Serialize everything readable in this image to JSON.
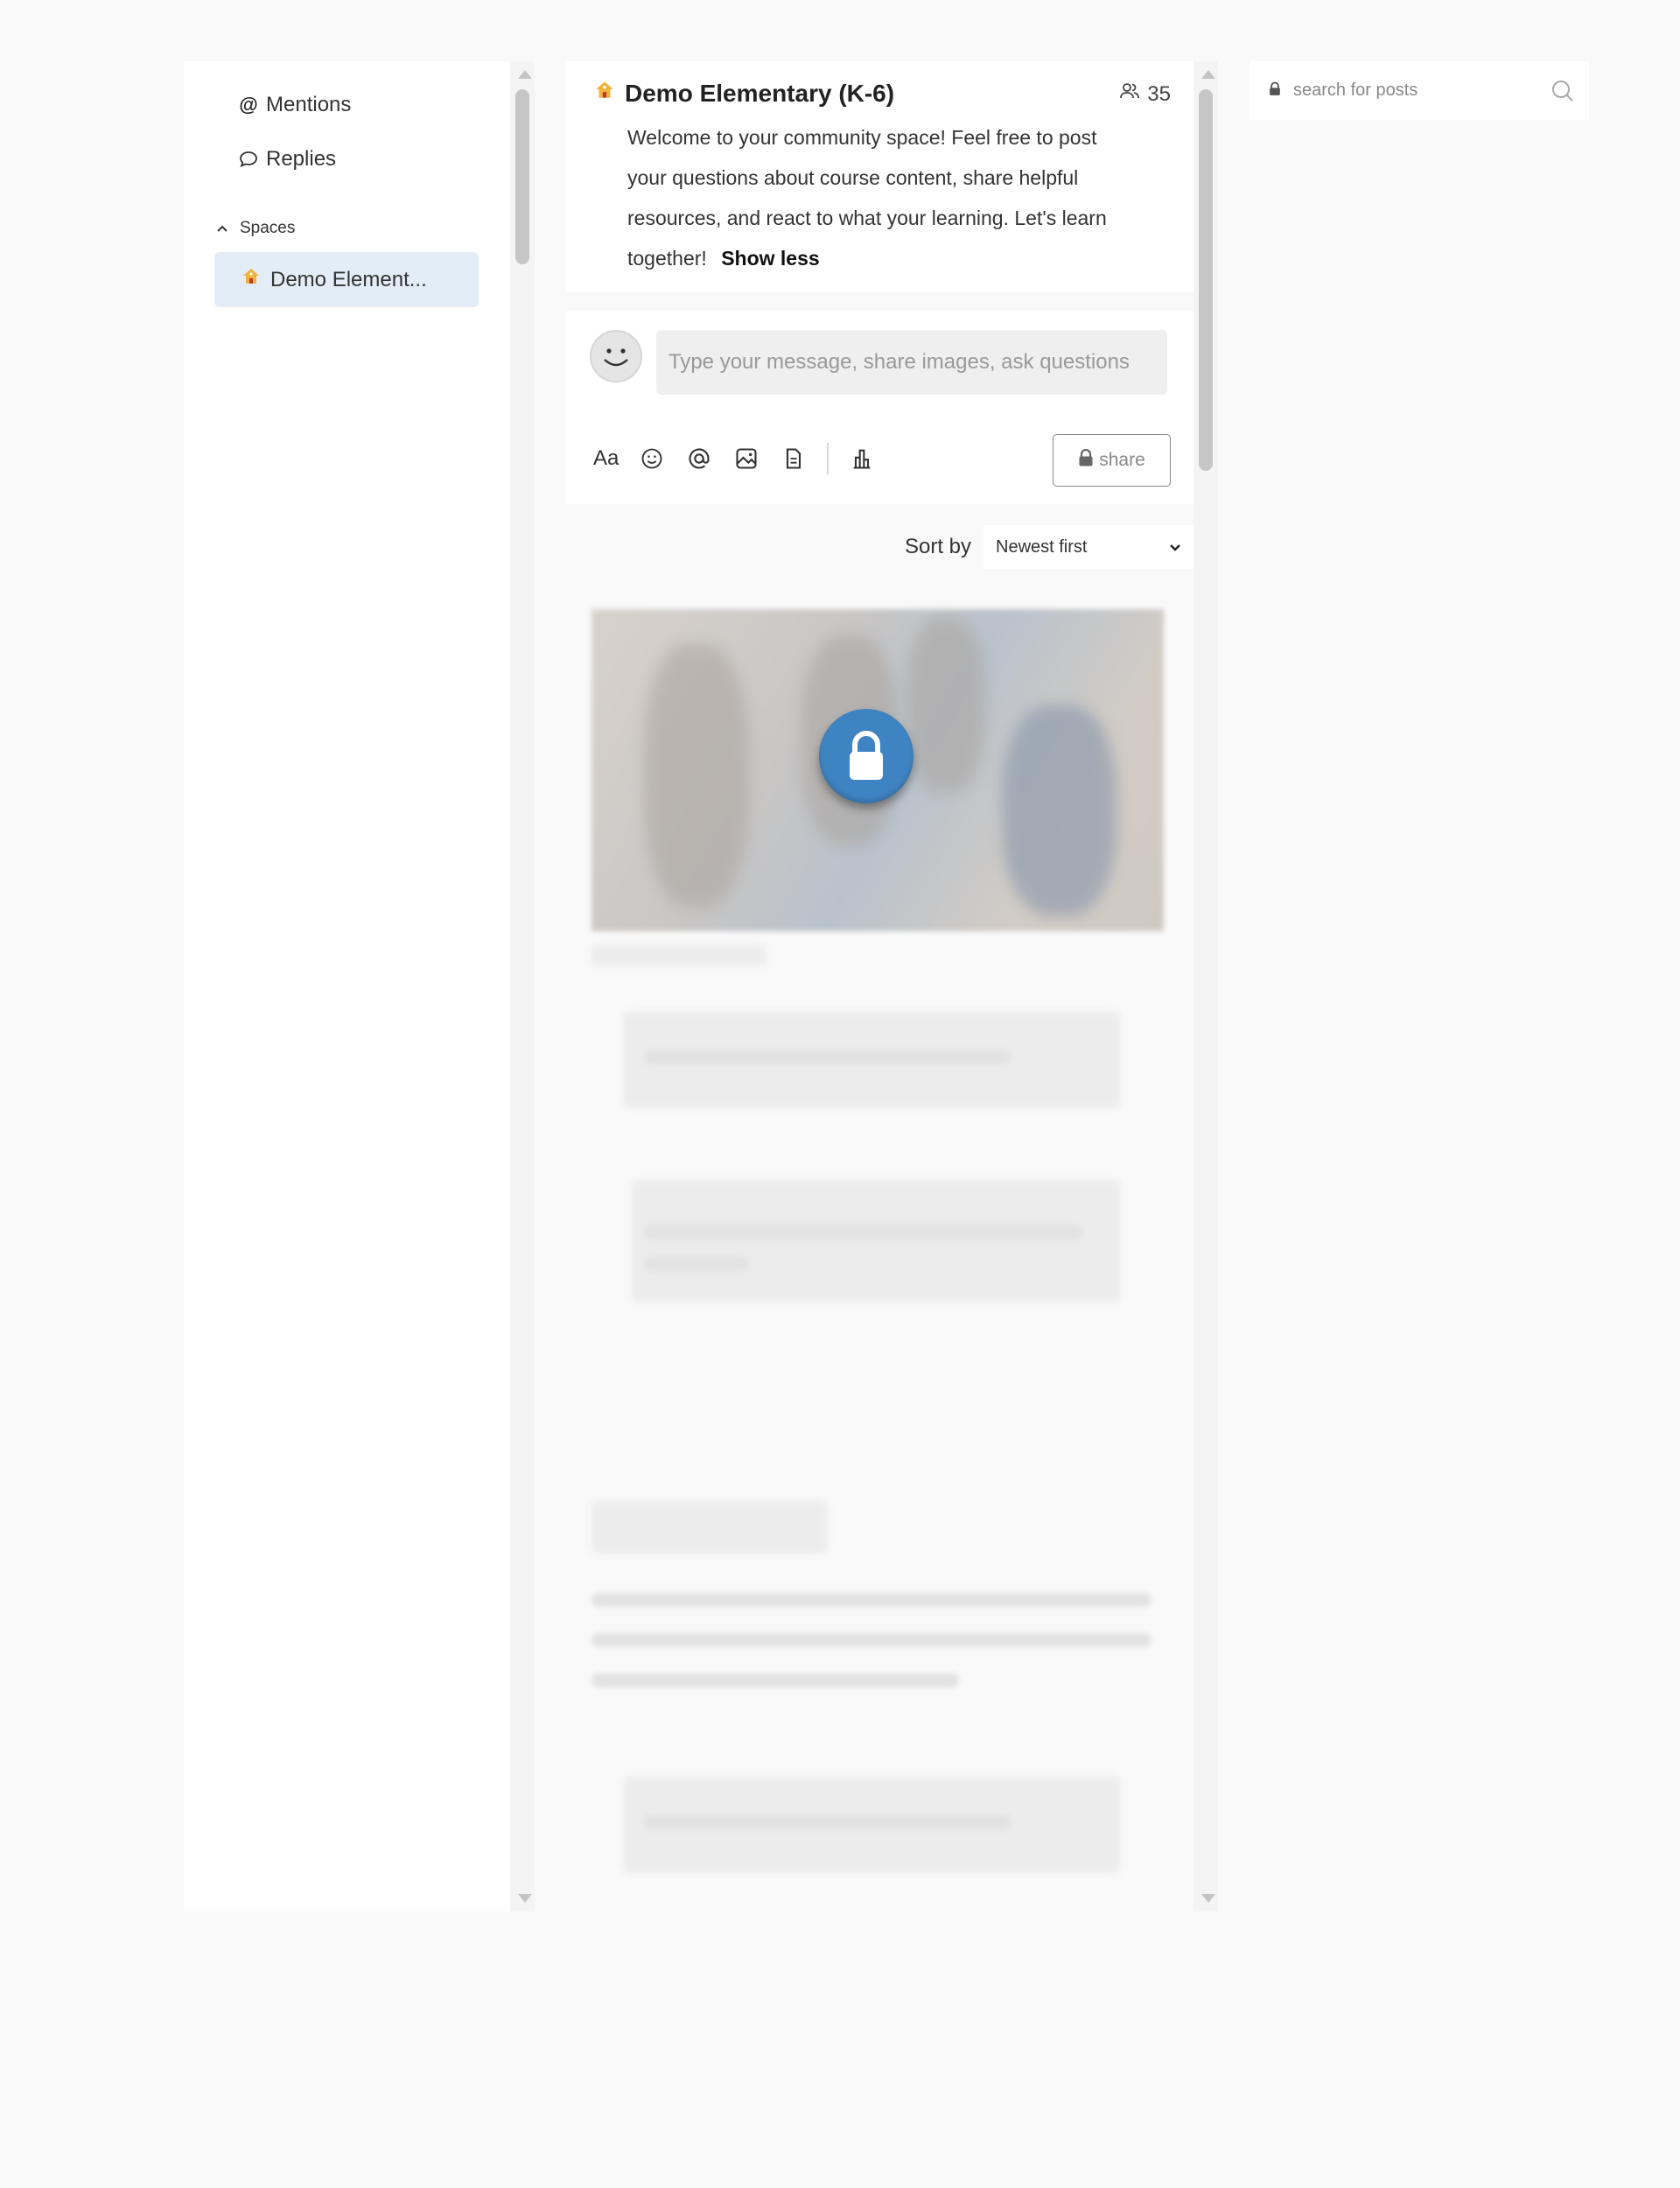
{
  "sidebar": {
    "mentions_label": "Mentions",
    "replies_label": "Replies",
    "spaces_label": "Spaces",
    "space_item_label": "Demo Element..."
  },
  "space": {
    "title": "Demo Elementary (K-6)",
    "member_count": "35",
    "description": "Welcome to your community space! Feel free to post your questions about course content, share helpful resources, and react to what your learning. Let's learn together!",
    "show_less_label": "Show less"
  },
  "composer": {
    "placeholder": "Type your message, share images, ask questions",
    "toolbar": {
      "text_format_label": "Aa"
    },
    "share_label": "share"
  },
  "sort": {
    "label": "Sort by",
    "selected": "Newest first"
  },
  "search": {
    "placeholder": "search for posts"
  },
  "colors": {
    "page_background": "#f9f9f9",
    "active_space_background": "#e3edf7",
    "lock_badge": "#3f84c2"
  },
  "icons": {
    "mentions": "at-icon",
    "replies": "speech-bubble-icon",
    "spaces_toggle": "chevron-up-icon",
    "space_emoji": "house-icon",
    "members": "people-icon",
    "lock": "lock-icon",
    "search": "search-icon"
  }
}
